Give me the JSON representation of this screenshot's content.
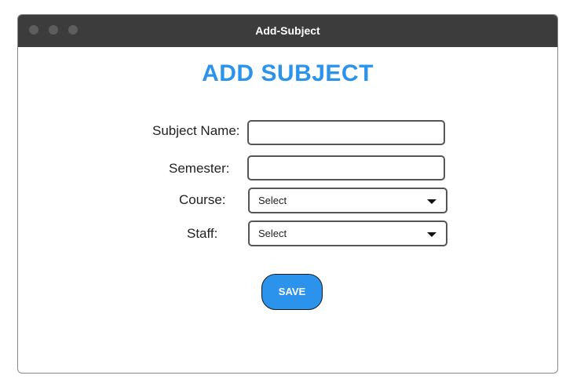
{
  "window": {
    "title": "Add-Subject"
  },
  "page": {
    "heading": "ADD SUBJECT"
  },
  "form": {
    "subject_name": {
      "label": "Subject Name:",
      "value": ""
    },
    "semester": {
      "label": "Semester:",
      "value": ""
    },
    "course": {
      "label": "Course:",
      "selected": "Select"
    },
    "staff": {
      "label": "Staff:",
      "selected": "Select"
    },
    "save_label": "SAVE"
  },
  "colors": {
    "accent": "#2b93ec",
    "titlebar": "#3c3c3c"
  }
}
